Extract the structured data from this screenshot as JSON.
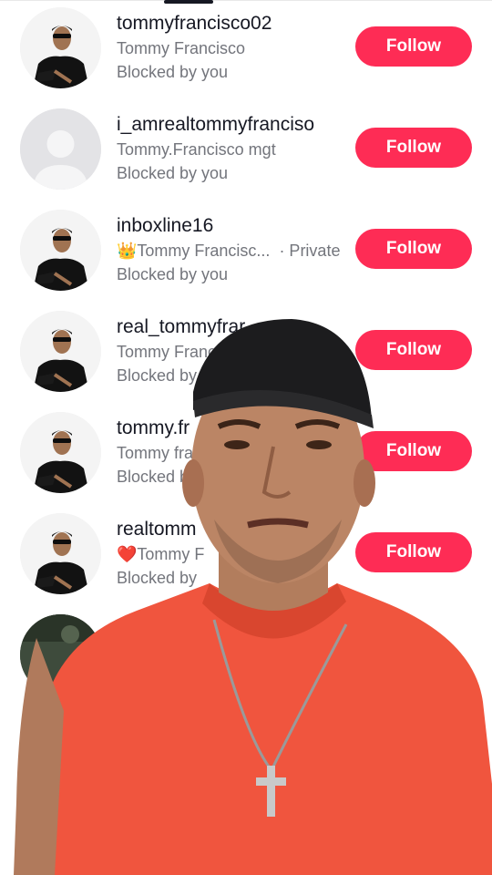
{
  "accounts": [
    {
      "username": "tommyfrancisco02",
      "display_name": "Tommy Francisco",
      "status": "Blocked by you",
      "follow_label": "Follow",
      "avatar": "photo-avatar"
    },
    {
      "username": "i_amrealtommyfranciso",
      "display_name": "Tommy.Francisco mgt",
      "status": "Blocked by you",
      "follow_label": "Follow",
      "avatar": "default-avatar"
    },
    {
      "username": "inboxline16",
      "display_name": "👑Tommy Francisc...",
      "private_label": "· Private",
      "status": "Blocked by you",
      "follow_label": "Follow",
      "avatar": "photo-avatar"
    },
    {
      "username": "real_tommyfrar",
      "display_name": "Tommy Franc",
      "status": "Blocked by",
      "follow_label": "Follow",
      "avatar": "photo-avatar"
    },
    {
      "username": "tommy.fr",
      "display_name": "Tommy fra",
      "status": "Blocked b",
      "follow_label": "Follow",
      "avatar": "photo-avatar"
    },
    {
      "username": "realtomm",
      "display_name": "❤️Tommy F",
      "status": "Blocked by",
      "follow_label": "Follow",
      "avatar": "photo-avatar"
    }
  ],
  "colors": {
    "follow_button": "#fe2c55",
    "overlay_shirt": "#f0553e"
  }
}
